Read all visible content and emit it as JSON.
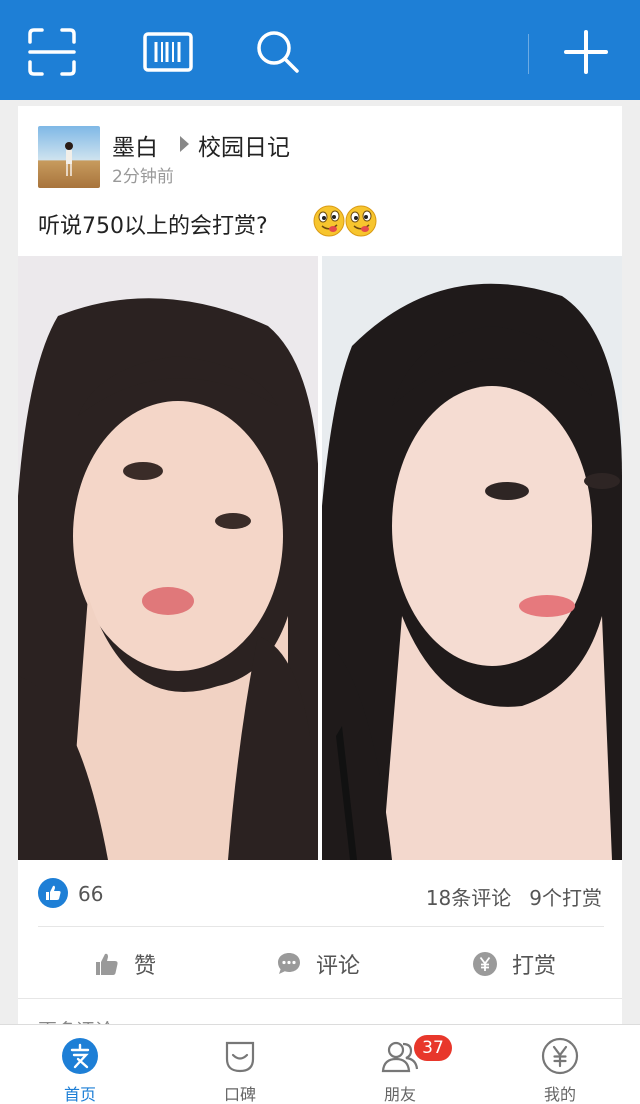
{
  "toolbar": {
    "icons": [
      "scan-icon",
      "barcode-icon",
      "search-icon",
      "add-icon"
    ]
  },
  "post": {
    "username": "墨白",
    "topic": "校园日记",
    "time": "2分钟前",
    "text": "听说750以上的会打赏?",
    "likes": "66",
    "comments": "18条评论",
    "rewards": "9个打赏",
    "actions": {
      "like": "赞",
      "comment": "评论",
      "reward": "打赏"
    },
    "more_comments": "更多评论"
  },
  "tabbar": {
    "tabs": [
      {
        "label": "首页",
        "icon": "home-icon",
        "active": true
      },
      {
        "label": "口碑",
        "icon": "koubei-icon",
        "active": false
      },
      {
        "label": "朋友",
        "icon": "friends-icon",
        "active": false,
        "badge": "37"
      },
      {
        "label": "我的",
        "icon": "wallet-icon",
        "active": false
      }
    ]
  },
  "colors": {
    "brand_blue": "#1e7fd6",
    "badge_red": "#e8372b"
  }
}
